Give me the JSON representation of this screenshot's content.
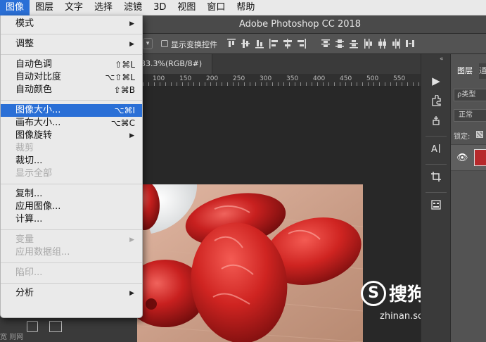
{
  "menubar": {
    "items": [
      "图像",
      "图层",
      "文字",
      "选择",
      "滤镜",
      "3D",
      "视图",
      "窗口",
      "帮助"
    ]
  },
  "titlebar": {
    "title": "Adobe Photoshop CC 2018"
  },
  "optionsbar": {
    "show_transform_controls": "显示变换控件"
  },
  "document": {
    "tab_label": "33.3%(RGB/8#)"
  },
  "ruler": {
    "labels": [
      "100",
      "150",
      "200",
      "250",
      "300",
      "350",
      "400",
      "450",
      "500",
      "550"
    ]
  },
  "menu": {
    "mode": {
      "label": "模式"
    },
    "adjust": {
      "label": "调整"
    },
    "auto_tone": {
      "label": "自动色调",
      "shortcut": "⇧⌘L"
    },
    "auto_contrast": {
      "label": "自动对比度",
      "shortcut": "⌥⇧⌘L"
    },
    "auto_color": {
      "label": "自动颜色",
      "shortcut": "⇧⌘B"
    },
    "image_size": {
      "label": "图像大小...",
      "shortcut": "⌥⌘I"
    },
    "canvas_size": {
      "label": "画布大小...",
      "shortcut": "⌥⌘C"
    },
    "image_rotation": {
      "label": "图像旋转"
    },
    "crop": {
      "label": "裁剪"
    },
    "trim": {
      "label": "裁切..."
    },
    "reveal_all": {
      "label": "显示全部"
    },
    "duplicate": {
      "label": "复制..."
    },
    "apply_image": {
      "label": "应用图像..."
    },
    "calculations": {
      "label": "计算..."
    },
    "variables": {
      "label": "变量"
    },
    "apply_data_set": {
      "label": "应用数据组..."
    },
    "trap": {
      "label": "陷印..."
    },
    "analysis": {
      "label": "分析"
    }
  },
  "leftstrip": {
    "text": "宽 则网"
  },
  "panel": {
    "layers_tab": "图层",
    "second_tab": "通",
    "search_placeholder": "ρ类型",
    "blend_mode": "正常",
    "lock_label": "锁定:"
  },
  "watermark": {
    "logo_letter": "S",
    "brand": "搜狗指南",
    "url": "zhinan.sogou.com"
  },
  "colors": {
    "menu_highlight": "#2a6fd6",
    "menu_background": "#eaeaea",
    "app_background": "#3c3c3c"
  }
}
